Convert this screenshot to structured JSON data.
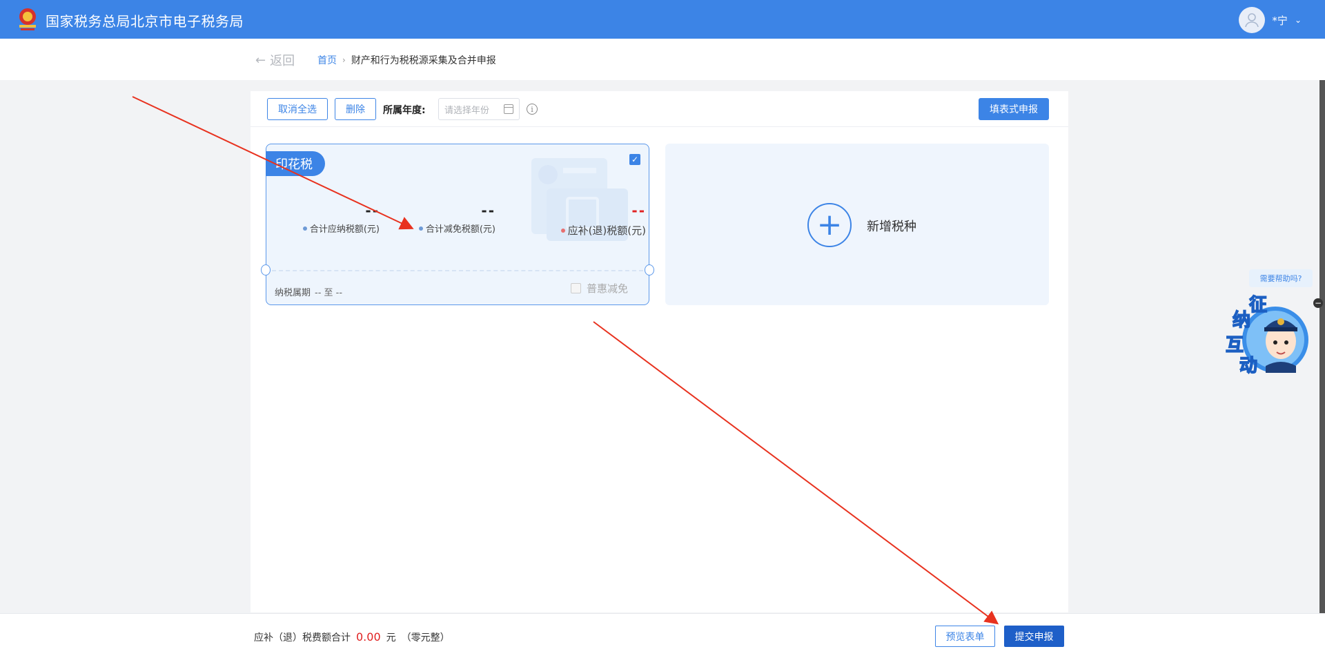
{
  "header": {
    "site_title": "国家税务总局北京市电子税务局",
    "user_name": "*宁",
    "colors": {
      "bar": "#3c84e6"
    }
  },
  "breadcrumb": {
    "back_label": "返回",
    "home": "首页",
    "current": "财产和行为税税源采集及合并申报"
  },
  "toolbar": {
    "cancel_all": "取消全选",
    "delete": "删除",
    "year_label": "所属年度:",
    "year_placeholder": "请选择年份",
    "fill_form": "填表式申报"
  },
  "tax_card": {
    "tag": "印花税",
    "checked": true,
    "metrics": [
      {
        "value": "--",
        "label": "合计应纳税额(元)"
      },
      {
        "value": "--",
        "label": "合计减免税额(元)"
      },
      {
        "value": "--",
        "label": "应补(退)税额(元)"
      }
    ],
    "period_label": "纳税属期",
    "period_value": "-- 至 --",
    "puhui_label": "普惠减免"
  },
  "add_card": {
    "label": "新增税种"
  },
  "footer": {
    "sum_label": "应补（退）税费额合计",
    "sum_amount": "0.00",
    "sum_unit": "元",
    "sum_words": "（零元整）",
    "preview": "预览表单",
    "submit": "提交申报"
  },
  "assistant": {
    "help_text": "需要帮助吗?",
    "badge_chars": [
      "征",
      "纳",
      "互",
      "动"
    ]
  }
}
